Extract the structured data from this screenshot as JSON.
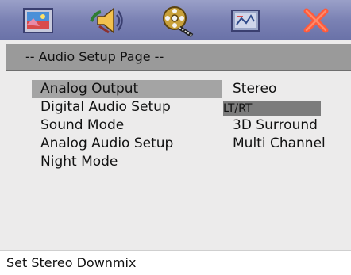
{
  "tabs": [
    {
      "icon": "picture-icon",
      "active": false
    },
    {
      "icon": "speaker-icon",
      "active": false
    },
    {
      "icon": "film-reel-icon",
      "active": true
    },
    {
      "icon": "video-settings-icon",
      "active": false
    },
    {
      "icon": "close-icon",
      "active": false
    }
  ],
  "page": {
    "title": "-- Audio Setup Page --"
  },
  "menu": {
    "items": [
      {
        "label": "Analog Output",
        "selected": true
      },
      {
        "label": "Digital Audio Setup",
        "selected": false
      },
      {
        "label": "Sound Mode",
        "selected": false
      },
      {
        "label": "Analog Audio Setup",
        "selected": false
      },
      {
        "label": "Night Mode",
        "selected": false
      }
    ]
  },
  "values": {
    "items": [
      {
        "label": "Stereo",
        "highlighted": false
      },
      {
        "label": "LT/RT",
        "highlighted": true
      },
      {
        "label": "3D Surround",
        "highlighted": false
      },
      {
        "label": "Multi Channel",
        "highlighted": false
      }
    ]
  },
  "status": {
    "text": "Set Stereo Downmix"
  },
  "colors": {
    "icon_bar": "#7b82b4",
    "title_bar": "#9a9a9a",
    "selected_row": "#a4a4a4",
    "highlighted_value": "#7c7c7c",
    "panel_background": "#ecebeb",
    "close_icon": "#ff5a3c"
  }
}
